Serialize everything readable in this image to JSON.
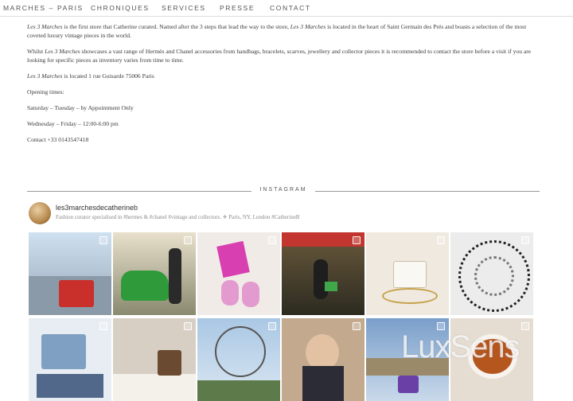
{
  "nav": {
    "items": [
      "MARCHES – PARIS",
      "CHRONIQUES",
      "SERVICES",
      "PRESSE",
      "CONTACT"
    ]
  },
  "content": {
    "p1_em1": "Les 3 Marches",
    "p1_text1": " is the first store that Catherine curated. Named after the 3 steps that lead the way to the store, ",
    "p1_em2": "Les 3 Marches",
    "p1_text2": " is located in the heart of Saint Germain des Prés and boasts a selection of the most coveted luxury vintage pieces in the world.",
    "p2_text1": "Whilst ",
    "p2_em": "Les 3 Marches",
    "p2_text2": " showcases a vast range of Hermès and Chanel accessories from handbags, bracelets, scarves, jewellery and collector pieces it is recommended to contact the store before a visit if you are looking for specific pieces as inventory varies from time to time.",
    "p3_em": "Les 3 Marches",
    "p3_text": " is located 1 rue Guisarde 75006 Paris",
    "opening_label": "Opening times:",
    "hours_1": "Saturday – Tuesday – by Appointment Only",
    "hours_2": "Wednesday – Friday – 12:00-6:00 pm",
    "contact": "Contact +33 0143547418"
  },
  "instagram": {
    "label": "INSTAGRAM",
    "handle": "les3marchesdecatherineb",
    "bio": "Fashion curator specialised in #hermes & #chanel #vintage and collectors. ✈ Paris, NY, London  #CatherineB",
    "posts": [
      {
        "subject": "red quilted handbag with Paris view",
        "tint": "#c8d4e2"
      },
      {
        "subject": "green vintage car",
        "tint": "#3f7a3a"
      },
      {
        "subject": "pink sandals and clutch",
        "tint": "#ead7d7"
      },
      {
        "subject": "woman with handbag at cafe",
        "tint": "#7b6a4e"
      },
      {
        "subject": "white handbag with jewellery",
        "tint": "#e9e1d4"
      },
      {
        "subject": "pearl and chain necklaces",
        "tint": "#dcdcdc"
      },
      {
        "subject": "denim quilted handbag",
        "tint": "#b7c7d9"
      },
      {
        "subject": "brown handbag on table",
        "tint": "#cdbfae"
      },
      {
        "subject": "ferris wheel in Paris",
        "tint": "#9dbad6"
      },
      {
        "subject": "woman in sunglasses",
        "tint": "#a88c73"
      },
      {
        "subject": "purple handbag by the Seine",
        "tint": "#6f8fb8"
      },
      {
        "subject": "coffee cup",
        "tint": "#d9cfc4"
      }
    ]
  },
  "watermark": "LuxSens"
}
